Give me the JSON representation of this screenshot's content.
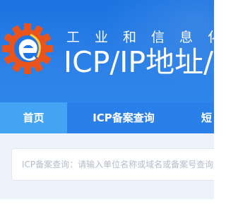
{
  "header": {
    "subtitle": "工业和信息化部",
    "title": "ICP/IP地址/域名信息备案管理系统",
    "logo": "miit-logo"
  },
  "nav": {
    "items": [
      {
        "label": "首页",
        "active": true
      },
      {
        "label": "ICP备案查询",
        "active": false
      },
      {
        "label": "短",
        "active": false
      }
    ]
  },
  "search": {
    "placeholder": "ICP备案查询：请输入单位名称或域名或备案号查询",
    "value": ""
  },
  "colors": {
    "header_blue": "#1a73e1",
    "nav_blue": "#2b7fe8",
    "nav_active": "#43a4f4",
    "search_bg": "#edf3fb",
    "logo_orange": "#e8541c"
  }
}
